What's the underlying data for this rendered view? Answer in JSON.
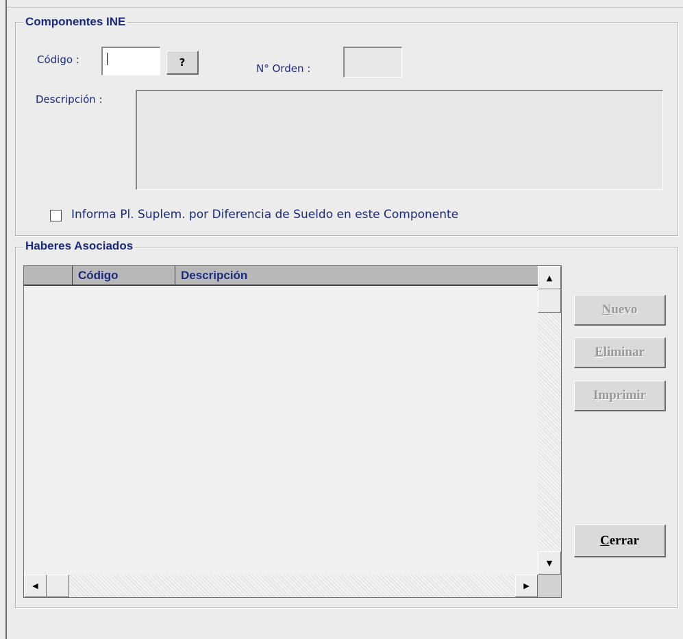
{
  "componentes": {
    "title": "Componentes INE",
    "codigo_label": "Código :",
    "codigo_value": "",
    "lookup_label": "?",
    "orden_label": "N° Orden :",
    "orden_value": "",
    "descripcion_label": "Descripción :",
    "descripcion_value": "",
    "checkbox_label": "Informa Pl. Suplem. por Diferencia de Sueldo en este Componente",
    "checkbox_checked": false
  },
  "haberes": {
    "title": "Haberes Asociados",
    "columns": [
      "",
      "Código",
      "Descripción"
    ],
    "rows": []
  },
  "buttons": {
    "nuevo": {
      "accel": "N",
      "rest": "uevo",
      "enabled": false
    },
    "eliminar": {
      "accel": "E",
      "rest": "liminar",
      "enabled": false
    },
    "imprimir": {
      "accel": "I",
      "rest": "mprimir",
      "enabled": false
    },
    "cerrar": {
      "accel": "C",
      "rest": "errar",
      "enabled": true
    }
  },
  "icons": {
    "scroll_up": "up-arrow-icon",
    "scroll_down": "down-arrow-icon",
    "scroll_left": "left-arrow-icon",
    "scroll_right": "right-arrow-icon"
  }
}
